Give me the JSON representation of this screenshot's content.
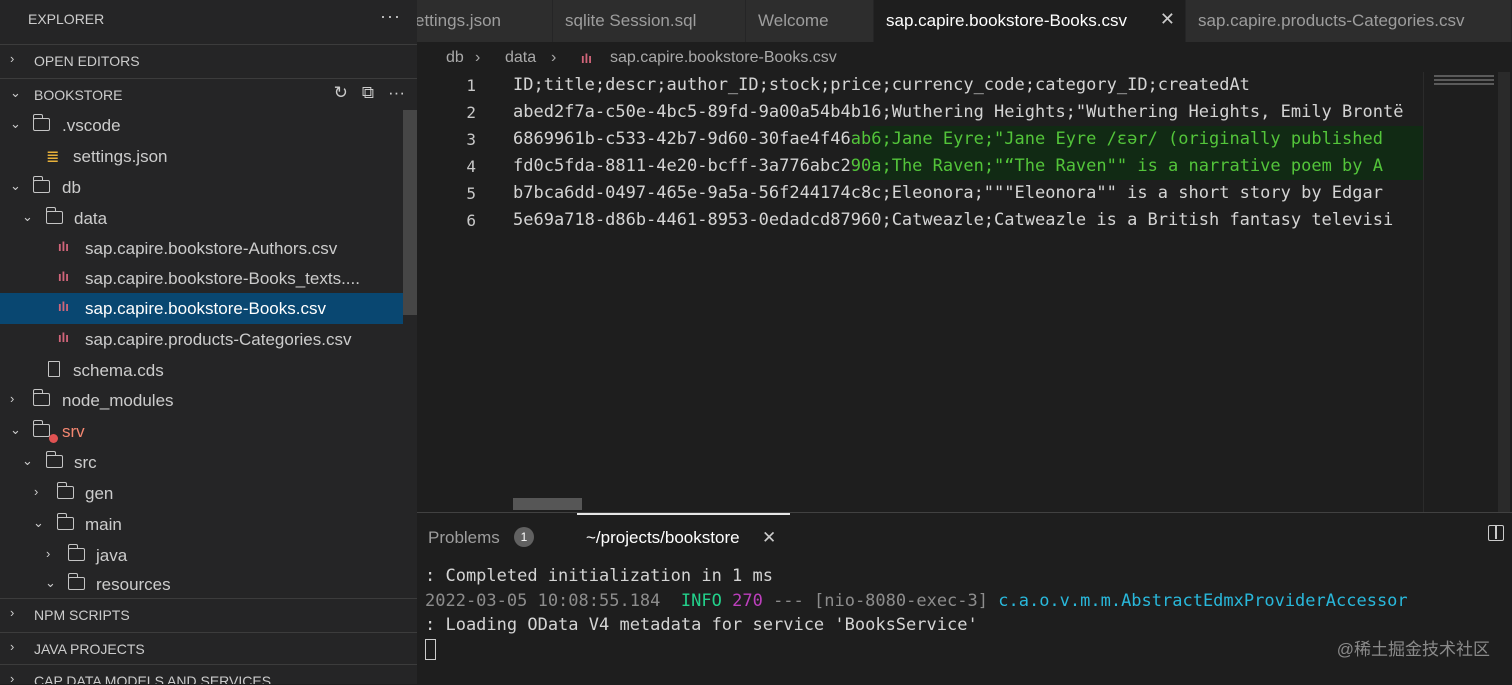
{
  "sidebar": {
    "title": "EXPLORER",
    "more": "···",
    "sections": {
      "open_editors": "OPEN EDITORS",
      "bookstore": "BOOKSTORE",
      "npm_scripts": "NPM SCRIPTS",
      "java_projects": "JAVA PROJECTS",
      "cap_data": "CAP DATA MODELS AND SERVICES"
    },
    "tree": [
      {
        "name": ".vscode",
        "icon": "folder-icon"
      },
      {
        "name": "settings.json",
        "icon": "database-icon"
      },
      {
        "name": "db",
        "icon": "folder-icon"
      },
      {
        "name": "data",
        "icon": "folder-icon"
      },
      {
        "name": "sap.capire.bookstore-Authors.csv",
        "icon": "csv-icon"
      },
      {
        "name": "sap.capire.bookstore-Books_texts....",
        "icon": "csv-icon"
      },
      {
        "name": "sap.capire.bookstore-Books.csv",
        "icon": "csv-icon",
        "selected": true
      },
      {
        "name": "sap.capire.products-Categories.csv",
        "icon": "csv-icon"
      },
      {
        "name": "schema.cds",
        "icon": "file-icon"
      },
      {
        "name": "node_modules",
        "icon": "folder-icon"
      },
      {
        "name": "srv",
        "icon": "folder-error-icon",
        "color": "#f48771"
      },
      {
        "name": "src",
        "icon": "folder-icon"
      },
      {
        "name": "gen",
        "icon": "folder-icon"
      },
      {
        "name": "main",
        "icon": "folder-icon"
      },
      {
        "name": "java",
        "icon": "folder-icon"
      },
      {
        "name": "resources",
        "icon": "folder-icon"
      }
    ]
  },
  "tabs": [
    {
      "label": "ettings.json"
    },
    {
      "label": "sqlite Session.sql"
    },
    {
      "label": "Welcome"
    },
    {
      "label": "sap.capire.bookstore-Books.csv",
      "active": true
    },
    {
      "label": "sap.capire.products-Categories.csv"
    }
  ],
  "breadcrumb": {
    "part1": "db",
    "part2": "data",
    "part3": "sap.capire.bookstore-Books.csv"
  },
  "editor": {
    "lines": [
      {
        "num": "1",
        "text": "ID;title;descr;author_ID;stock;price;currency_code;category_ID;createdAt"
      },
      {
        "num": "2",
        "text": "abed2f7a-c50e-4bc5-89fd-9a00a54b4b16;Wuthering Heights;\"Wuthering Heights, Emily Brontë"
      },
      {
        "num": "3",
        "text": "6869961b-c533-42b7-9d60-30fae4f46",
        "hl": "ab6;Jane Eyre;\"Jane Eyre /ɛər/ (originally published"
      },
      {
        "num": "4",
        "text": "fd0c5fda-8811-4e20-bcff-3a776abc2",
        "hl": "90a;The Raven;\"“The Raven\"\" is a narrative poem by A"
      },
      {
        "num": "5",
        "text": "b7bca6dd-0497-465e-9a5a-56f244174c8c;Eleonora;\"\"\"Eleonora\"\" is a short story by Edgar"
      },
      {
        "num": "6",
        "text": "5e69a718-d86b-4461-8953-0edadcd87960;Catweazle;Catweazle is a British fantasy televisi"
      }
    ]
  },
  "panel": {
    "problems_label": "Problems",
    "problems_count": "1",
    "terminal_label": "~/projects/bookstore",
    "close": "✕",
    "terminal": {
      "line1": ": Completed initialization in 1 ms",
      "line2_ts": "2022-03-05 10:08:55.184",
      "line2_level": "INFO",
      "line2_pid": "270",
      "line2_mid": "--- [nio-8080-exec-3]",
      "line2_logger": "c.a.o.v.m.m.AbstractEdmxProviderAccessor",
      "line3": ": Loading OData V4 metadata for service 'BooksService'"
    }
  },
  "watermark": "@稀土掘金技术社区"
}
